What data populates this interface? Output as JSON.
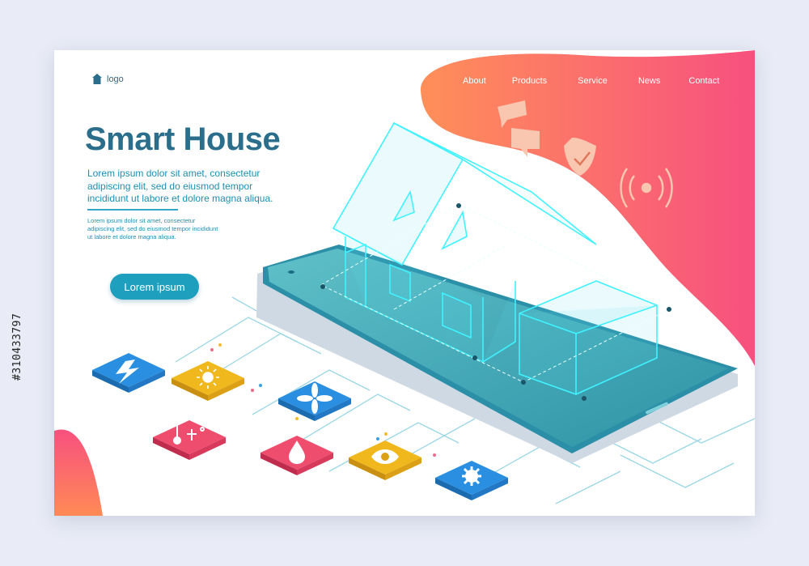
{
  "header": {
    "logo_icon": "home-icon",
    "logo_text": "logo",
    "nav": [
      "About",
      "Products",
      "Service",
      "News",
      "Contact"
    ]
  },
  "hero": {
    "title": "Smart House",
    "lead": "Lorem ipsum dolor sit amet, consectetur adipiscing elit, sed do eiusmod tempor incididunt ut labore et dolore magna aliqua.",
    "small": "Lorem ipsum dolor sit amet, consectetur adipiscing elit, sed do eiusmod tempor incididunt ut labore et dolore magna aliqua.",
    "button": "Lorem ipsum"
  },
  "floating_icons": [
    "chat-bubbles-icon",
    "shield-check-icon",
    "wireless-signal-icon"
  ],
  "device_tiles": [
    {
      "icon": "lightning-icon",
      "color": "#2a8fe0"
    },
    {
      "icon": "sun-icon",
      "color": "#f0b81c"
    },
    {
      "icon": "fan-icon",
      "color": "#2a8fe0"
    },
    {
      "icon": "thermometer-icon",
      "color": "#ef4d6e"
    },
    {
      "icon": "water-drop-icon",
      "color": "#ef4d6e"
    },
    {
      "icon": "eye-icon",
      "color": "#f0b81c"
    },
    {
      "icon": "gear-icon",
      "color": "#2a8fe0"
    }
  ],
  "colors": {
    "accent_gradient_start": "#ff8f59",
    "accent_gradient_end": "#f7507f",
    "title": "#2a6e8c",
    "text": "#1c8fb4",
    "button": "#1e9fbe",
    "phone_screen": "#3fa9b4",
    "wireframe": "#40f2ff"
  },
  "watermark_side": "#310433797"
}
